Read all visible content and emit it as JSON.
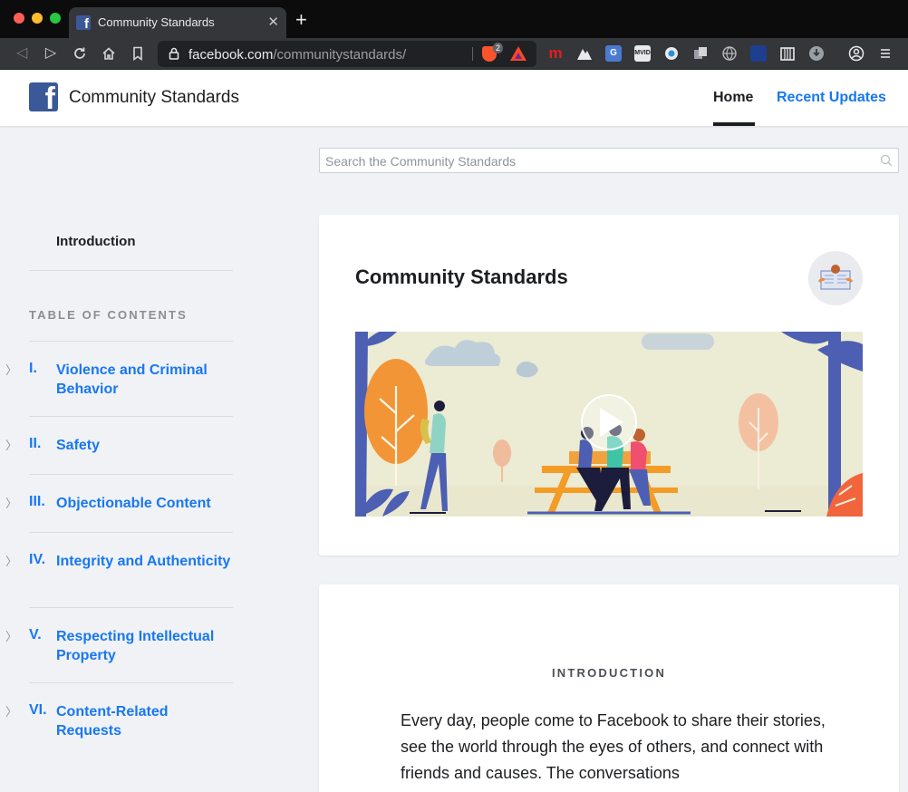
{
  "browser": {
    "tab_title": "Community Standards",
    "url_host": "facebook.com",
    "url_path": "/communitystandards/",
    "shields_count": "2",
    "extension_icons": [
      "mega-icon",
      "mountain-icon",
      "translate-icon",
      "mvid-icon",
      "eye-icon",
      "copy-icon",
      "globe-icon",
      "flag-icon",
      "archive-icon",
      "download-icon",
      "profile-icon",
      "menu-icon"
    ]
  },
  "header": {
    "site_title": "Community Standards",
    "nav": [
      {
        "label": "Home"
      },
      {
        "label": "Recent Updates"
      }
    ],
    "accent_color": "#1877f2"
  },
  "search": {
    "placeholder": "Search the Community Standards"
  },
  "sidebar": {
    "intro_label": "Introduction",
    "toc_title": "TABLE OF CONTENTS",
    "items": [
      {
        "num": "I.",
        "label": "Violence and Criminal Behavior"
      },
      {
        "num": "II.",
        "label": "Safety"
      },
      {
        "num": "III.",
        "label": "Objectionable Content"
      },
      {
        "num": "IV.",
        "label": "Integrity and Authenticity"
      },
      {
        "num": "V.",
        "label": "Respecting Intellectual Property"
      },
      {
        "num": "VI.",
        "label": "Content-Related Requests"
      }
    ]
  },
  "main": {
    "card_title": "Community Standards",
    "section_label": "INTRODUCTION",
    "intro_text": "Every day, people come to Facebook to share their stories, see the world through the eyes of others, and connect with friends and causes. The conversations"
  }
}
